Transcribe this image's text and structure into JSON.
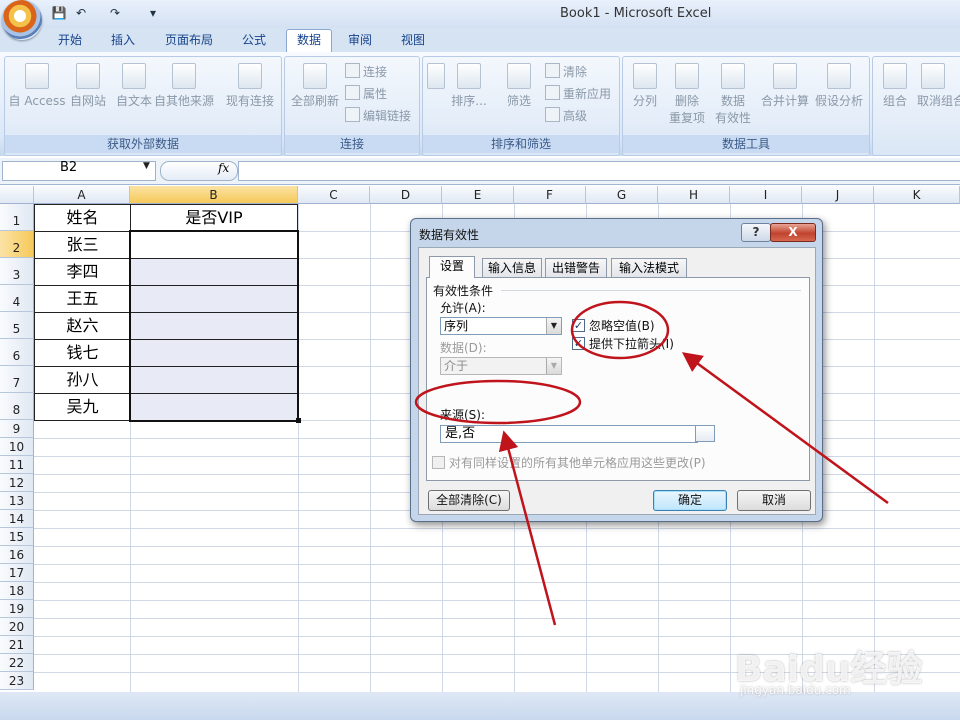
{
  "app": {
    "title": "Book1 - Microsoft Excel",
    "quick_access": [
      "save-icon",
      "undo-icon",
      "redo-icon",
      "customize-icon"
    ]
  },
  "tabs": [
    "开始",
    "插入",
    "页面布局",
    "公式",
    "数据",
    "审阅",
    "视图"
  ],
  "active_tab": "数据",
  "ribbon": {
    "groups": {
      "external_data": {
        "label": "获取外部数据",
        "buttons": [
          "自 Access",
          "自网站",
          "自文本",
          "自其他来源",
          "现有连接"
        ]
      },
      "connections": {
        "label": "连接",
        "refresh_all": "全部刷新",
        "small": [
          "连接",
          "属性",
          "编辑链接"
        ]
      },
      "sort_filter": {
        "label": "排序和筛选",
        "sort": "排序...",
        "filter": "筛选",
        "small": [
          "清除",
          "重新应用",
          "高级"
        ]
      },
      "data_tools": {
        "label": "数据工具",
        "split": "分列",
        "remove_dup": [
          "删除",
          "重复项"
        ],
        "validation": [
          "数据",
          "有效性"
        ],
        "consolidate": "合并计算",
        "whatif": "假设分析"
      },
      "outline": {
        "group": "组合",
        "ungroup": "取消组合"
      }
    }
  },
  "formula_bar": {
    "name_box": "B2",
    "fx": "fx",
    "formula": ""
  },
  "sheet": {
    "columns": [
      "A",
      "B",
      "C",
      "D",
      "E",
      "F",
      "G",
      "H",
      "I",
      "J",
      "K"
    ],
    "rows": [
      "1",
      "2",
      "3",
      "4",
      "5",
      "6",
      "7",
      "8",
      "9",
      "10",
      "11",
      "12",
      "13",
      "14",
      "15",
      "16",
      "17",
      "18",
      "19",
      "20",
      "21",
      "22",
      "23"
    ],
    "header_a": "姓名",
    "header_b": "是否VIP",
    "names": [
      "张三",
      "李四",
      "王五",
      "赵六",
      "钱七",
      "孙八",
      "吴九"
    ]
  },
  "dialog": {
    "title": "数据有效性",
    "help": "?",
    "close": "X",
    "tabs": [
      "设置",
      "输入信息",
      "出错警告",
      "输入法模式"
    ],
    "section": "有效性条件",
    "allow_label": "允许(A):",
    "allow_value": "序列",
    "ignore_blank": "忽略空值(B)",
    "dropdown": "提供下拉箭头(I)",
    "data_label": "数据(D):",
    "data_value": "介于",
    "source_label": "来源(S):",
    "source_value": "是,否",
    "apply_all": "对有同样设置的所有其他单元格应用这些更改(P)",
    "clear_all": "全部清除(C)",
    "ok": "确定",
    "cancel": "取消"
  },
  "watermark": {
    "brand": "Baidu经验",
    "url": "jingyan.baidu.com"
  },
  "colors": {
    "annotation": "#c0141c",
    "selection_header": "#f6c95a",
    "validation_fill": "#e8ebf5"
  }
}
